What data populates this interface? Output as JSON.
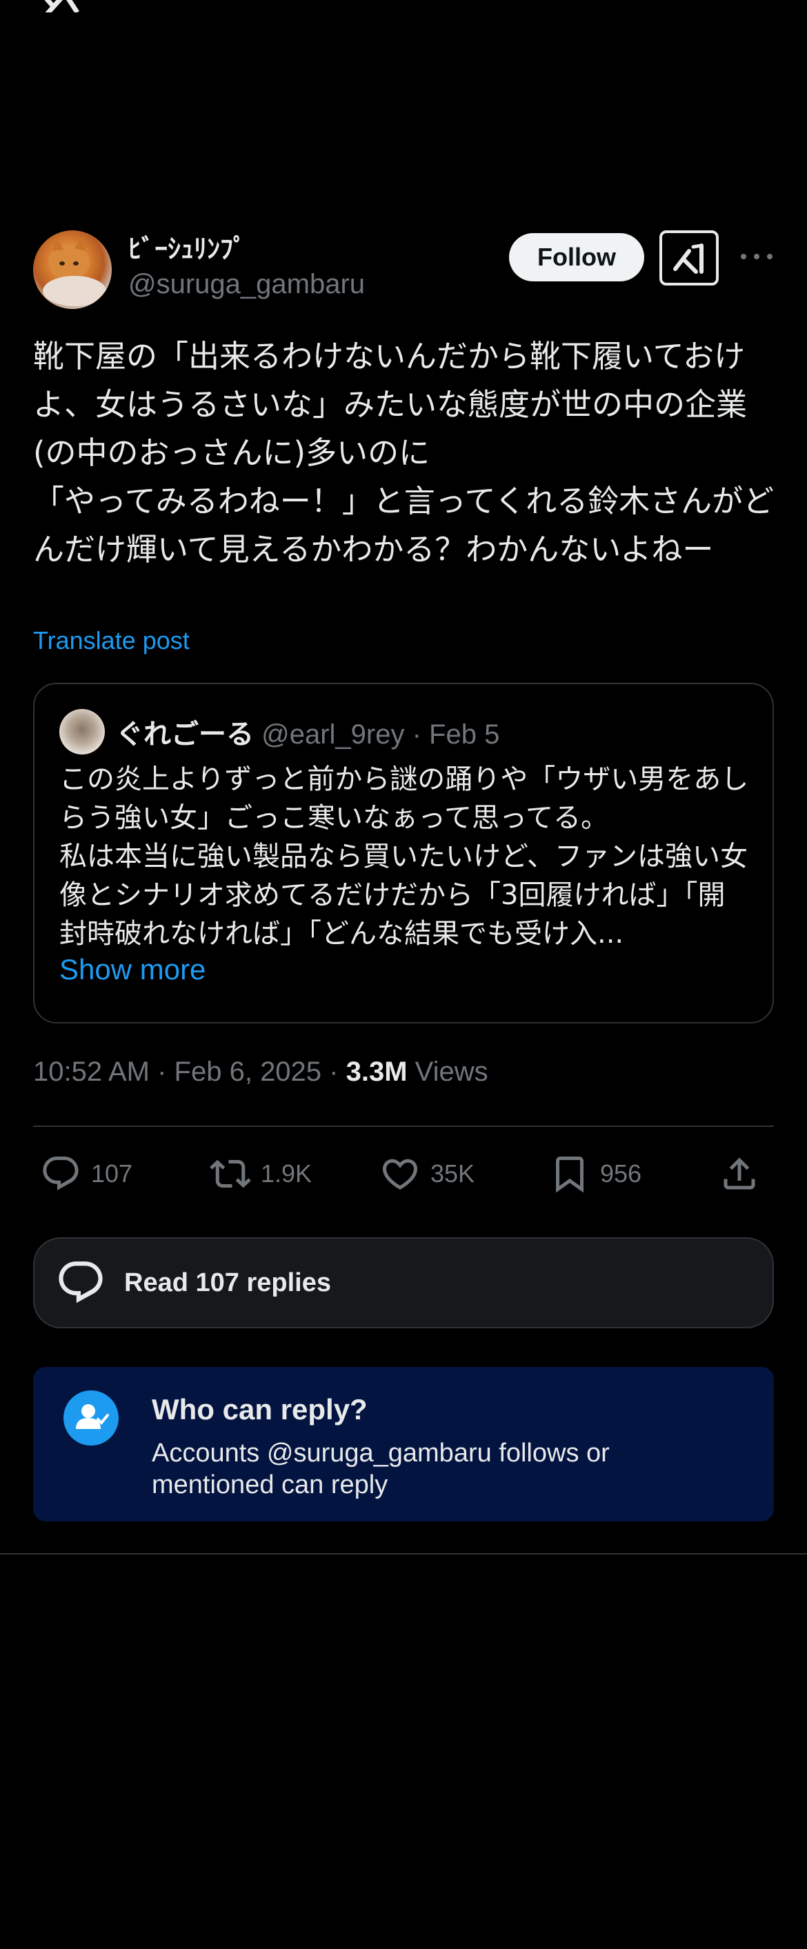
{
  "author": {
    "display_name": "ﾋﾞｰｼｭﾘﾝﾌﾟ",
    "handle": "@suruga_gambaru"
  },
  "header": {
    "follow_label": "Follow"
  },
  "post": {
    "text": "靴下屋の「出来るわけないんだから靴下履いておけよ、女はうるさいな」みたいな態度が世の中の企業(の中のおっさんに)多いのに\n「やってみるわねー！」と言ってくれる鈴木さんがどんだけ輝いて見えるかわかる？わかんないよねー",
    "translate_label": "Translate post"
  },
  "quote": {
    "name": "ぐれごーる",
    "handle": "@earl_9rey",
    "date": "· Feb 5",
    "text": "この炎上よりずっと前から謎の踊りや「ウザい男をあしらう強い女」ごっこ寒いなぁって思ってる。\n私は本当に強い製品なら買いたいけど、ファンは強い女像とシナリオ求めてるだけだから「3回履ければ」「開封時破れなければ」「どんな結果でも受け入...",
    "show_more_label": "Show more"
  },
  "meta": {
    "time": "10:52 AM · Feb 6, 2025 · ",
    "views_count": "3.3M",
    "views_label": " Views"
  },
  "actions": {
    "replies": "107",
    "reposts": "1.9K",
    "likes": "35K",
    "bookmarks": "956"
  },
  "read_replies_label": "Read 107 replies",
  "who_can_reply": {
    "title": "Who can reply?",
    "description": "Accounts @suruga_gambaru follows or mentioned can reply"
  },
  "colors": {
    "background": "#000000",
    "accent": "#1d9bf0",
    "muted": "#71767b",
    "who_card_bg": "#031440"
  }
}
